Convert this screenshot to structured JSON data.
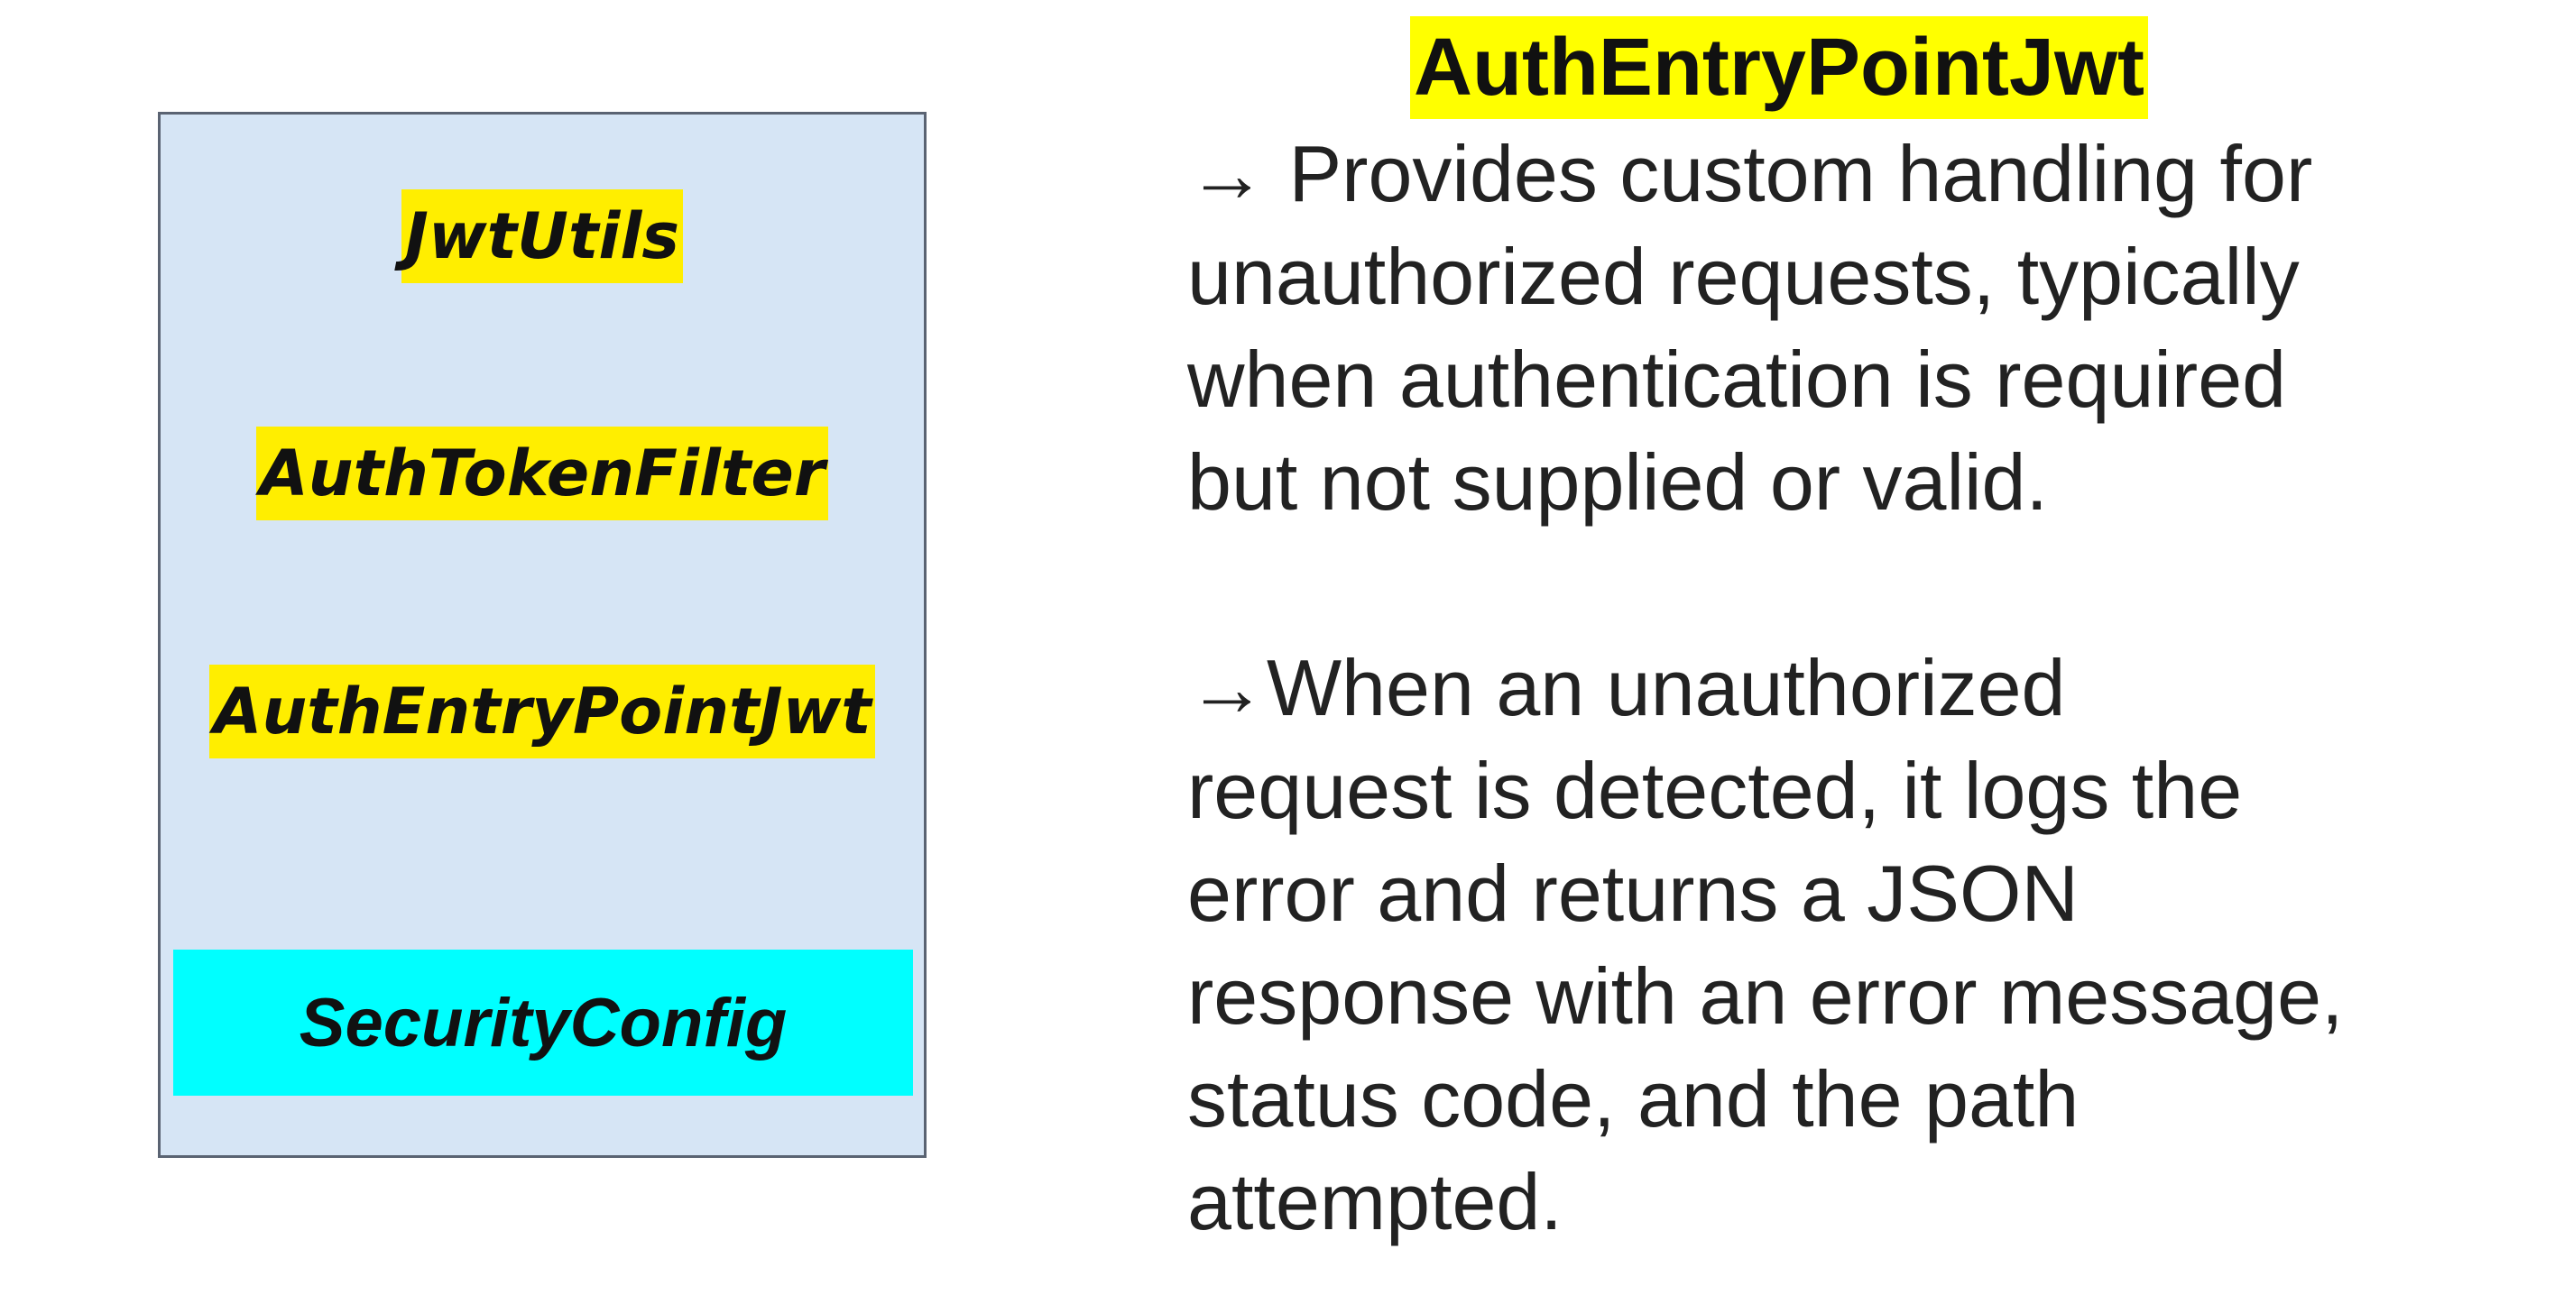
{
  "components": [
    {
      "label": "JwtUtils"
    },
    {
      "label": "AuthTokenFilter"
    },
    {
      "label": "AuthEntryPointJwt"
    }
  ],
  "config_box": {
    "label": "SecurityConfig"
  },
  "heading": "AuthEntryPointJwt",
  "descriptions": [
    {
      "lines": [
        "→ Provides custom handling for",
        "unauthorized requests, typically",
        "when authentication is required",
        "but not supplied or valid."
      ]
    },
    {
      "lines": [
        "→When an unauthorized",
        "request is detected, it logs the",
        "error and returns a JSON",
        "response with an error message,",
        "status code, and the path",
        "attempted."
      ]
    }
  ],
  "colors": {
    "panel_fill": "#d6e5f5",
    "panel_border": "#5a6372",
    "highlight_yellow": "#ffee00",
    "config_cyan": "#00ffff"
  }
}
